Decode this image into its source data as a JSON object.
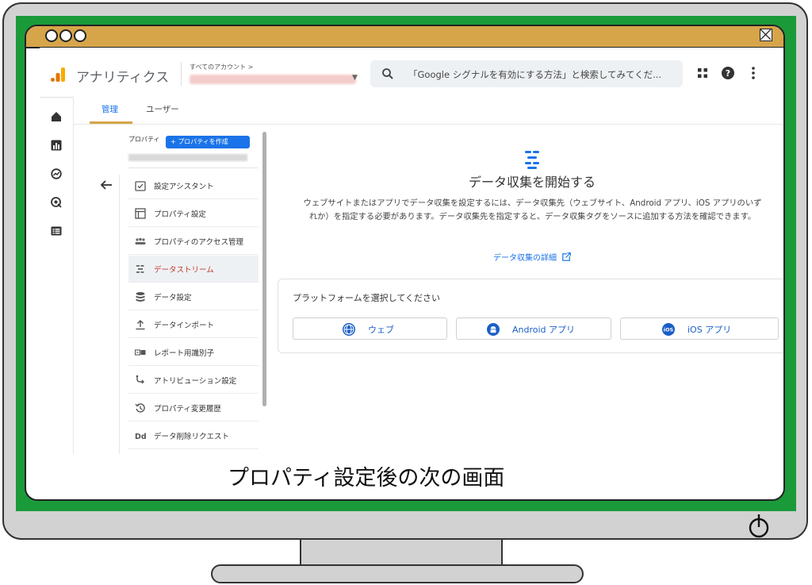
{
  "app": {
    "title": "アナリティクス",
    "account_breadcrumb": "すべてのアカウント >",
    "search_placeholder": "「Google シグナルを有効にする方法」と検索してみてくだ..."
  },
  "tabs": {
    "admin": "管理",
    "user": "ユーザー"
  },
  "property": {
    "label": "プロパティ",
    "create_button": "+ プロパティを作成"
  },
  "nav": {
    "items": [
      {
        "label": "設定アシスタント",
        "icon": "checklist-icon"
      },
      {
        "label": "プロパティ設定",
        "icon": "property-settings-icon"
      },
      {
        "label": "プロパティのアクセス管理",
        "icon": "people-icon"
      },
      {
        "label": "データストリーム",
        "icon": "data-stream-icon",
        "active": true
      },
      {
        "label": "データ設定",
        "icon": "database-icon"
      },
      {
        "label": "データインポート",
        "icon": "upload-icon"
      },
      {
        "label": "レポート用識別子",
        "icon": "identifier-icon"
      },
      {
        "label": "アトリビューション設定",
        "icon": "attribution-icon"
      },
      {
        "label": "プロパティ変更履歴",
        "icon": "history-icon"
      },
      {
        "label": "データ削除リクエスト",
        "icon": "delete-request-icon"
      }
    ]
  },
  "main": {
    "title": "データ収集を開始する",
    "description": "ウェブサイトまたはアプリでデータ収集を設定するには、データ収集先（ウェブサイト、Android アプリ、iOS アプリのいずれか）を指定する必要があります。データ収集先を指定すると、データ収集タグをソースに追加する方法を確認できます。",
    "detail_link": "データ収集の詳細",
    "platform_prompt": "プラットフォームを選択してください",
    "platforms": [
      {
        "label": "ウェブ",
        "icon": "globe-icon"
      },
      {
        "label": "Android アプリ",
        "icon": "android-icon"
      },
      {
        "label": "iOS アプリ",
        "icon": "ios-icon"
      }
    ]
  },
  "caption": "プロパティ設定後の次の画面",
  "colors": {
    "brand_blue": "#1a73e8",
    "frame_green": "#1b9a3a",
    "titlebar_gold": "#d6a54a",
    "active_red": "#c0392b"
  }
}
